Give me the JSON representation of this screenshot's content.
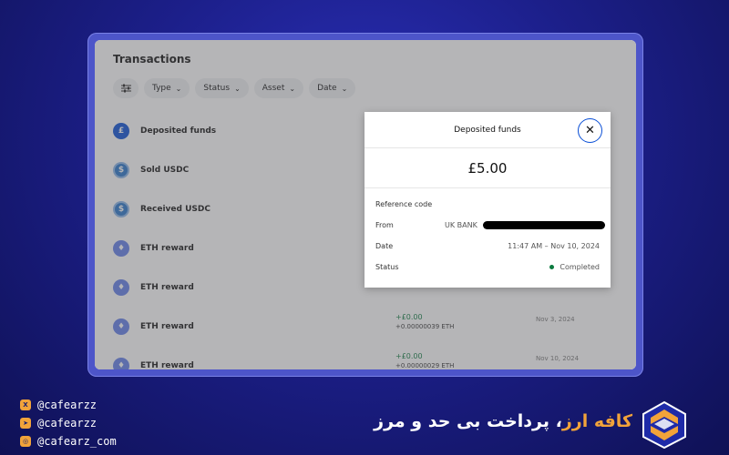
{
  "app": {
    "title": "Transactions",
    "filters": [
      {
        "label": "Type"
      },
      {
        "label": "Status"
      },
      {
        "label": "Asset"
      },
      {
        "label": "Date"
      }
    ],
    "transactions": [
      {
        "label": "Deposited funds",
        "icon": "pound-icon",
        "amount_fiat": "",
        "amount_crypto": "",
        "date": ""
      },
      {
        "label": "Sold USDC",
        "icon": "usdc-icon",
        "amount_fiat": "",
        "amount_crypto": "",
        "date": ""
      },
      {
        "label": "Received USDC",
        "icon": "usdc-icon",
        "amount_fiat": "",
        "amount_crypto": "",
        "date": ""
      },
      {
        "label": "ETH reward",
        "icon": "eth-icon",
        "amount_fiat": "",
        "amount_crypto": "",
        "date": ""
      },
      {
        "label": "ETH reward",
        "icon": "eth-icon",
        "amount_fiat": "",
        "amount_crypto": "",
        "date": ""
      },
      {
        "label": "ETH reward",
        "icon": "eth-icon",
        "amount_fiat": "+£0.00",
        "amount_crypto": "+0.00000039 ETH",
        "date": "Nov 3, 2024"
      },
      {
        "label": "ETH reward",
        "icon": "eth-icon",
        "amount_fiat": "+£0.00",
        "amount_crypto": "+0.00000029 ETH",
        "date": "Nov 10, 2024"
      }
    ]
  },
  "modal": {
    "title": "Deposited funds",
    "close_icon": "close-icon",
    "amount": "£5.00",
    "details": {
      "reference_label": "Reference code",
      "from_label": "From",
      "from_value": "UK BANK",
      "date_label": "Date",
      "date_value": "11:47 AM – Nov 10, 2024",
      "status_label": "Status",
      "status_value": "Completed"
    }
  },
  "branding": {
    "socials": [
      {
        "icon": "x-icon",
        "handle": "@cafearzz"
      },
      {
        "icon": "telegram-icon",
        "handle": "@cafearzz"
      },
      {
        "icon": "instagram-icon",
        "handle": "@cafearz_com"
      }
    ],
    "tagline_accent": "کافه ارز",
    "tagline_rest": "، پرداخت بی حد و مرز"
  },
  "colors": {
    "background": "#1c1f8a",
    "accent_orange": "#f2a33a",
    "primary_blue": "#0a4fd6",
    "positive_green": "#0b7a3e"
  }
}
